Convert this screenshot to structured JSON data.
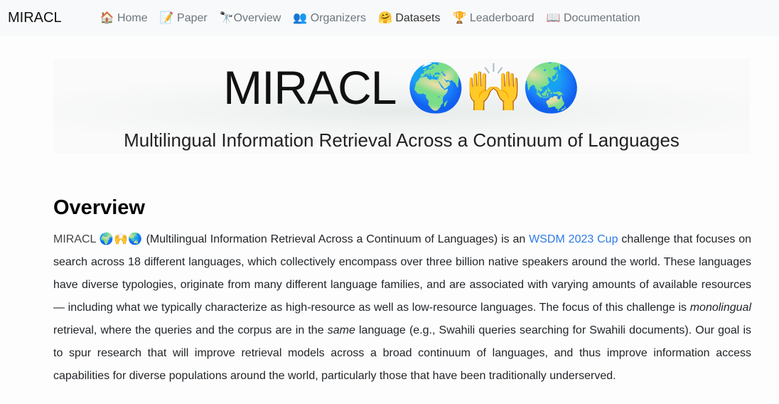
{
  "nav": {
    "brand": "MIRACL",
    "items": [
      {
        "icon": "🏠",
        "label": "Home"
      },
      {
        "icon": "📝",
        "label": "Paper"
      },
      {
        "icon": "🔭",
        "label": "Overview"
      },
      {
        "icon": "👥",
        "label": "Organizers"
      },
      {
        "icon": "🤗",
        "label": "Datasets",
        "active": true
      },
      {
        "icon": "🏆",
        "label": "Leaderboard"
      },
      {
        "icon": "📖",
        "label": "Documentation"
      }
    ]
  },
  "banner": {
    "title": "MIRACL 🌍🙌🌏",
    "subtitle": "Multilingual Information Retrieval Across a Continuum of Languages"
  },
  "overview": {
    "heading": "Overview",
    "brand": "MIRACL 🌍🙌🌏",
    "text1": " (Multilingual Information Retrieval Across a Continuum of Languages) is an ",
    "link": "WSDM 2023 Cup",
    "text2": " challenge that focuses on search across 18 different languages, which collectively encompass over three billion native speakers around the world. These languages have diverse typologies, originate from many different language families, and are associated with varying amounts of available resources — including what we typically characterize as high-resource as well as low-resource languages. The focus of this challenge is ",
    "em1": "monolingual",
    "text3": " retrieval, where the queries and the corpus are in the ",
    "em2": "same",
    "text4": " language (e.g., Swahili queries searching for Swahili documents). Our goal is to spur research that will improve retrieval models across a broad continuum of languages, and thus improve information access capabilities for diverse populations around the world, particularly those that have been traditionally underserved."
  },
  "colors": {
    "link": "#2e7ae6",
    "navbar": "#f8f9fa"
  }
}
